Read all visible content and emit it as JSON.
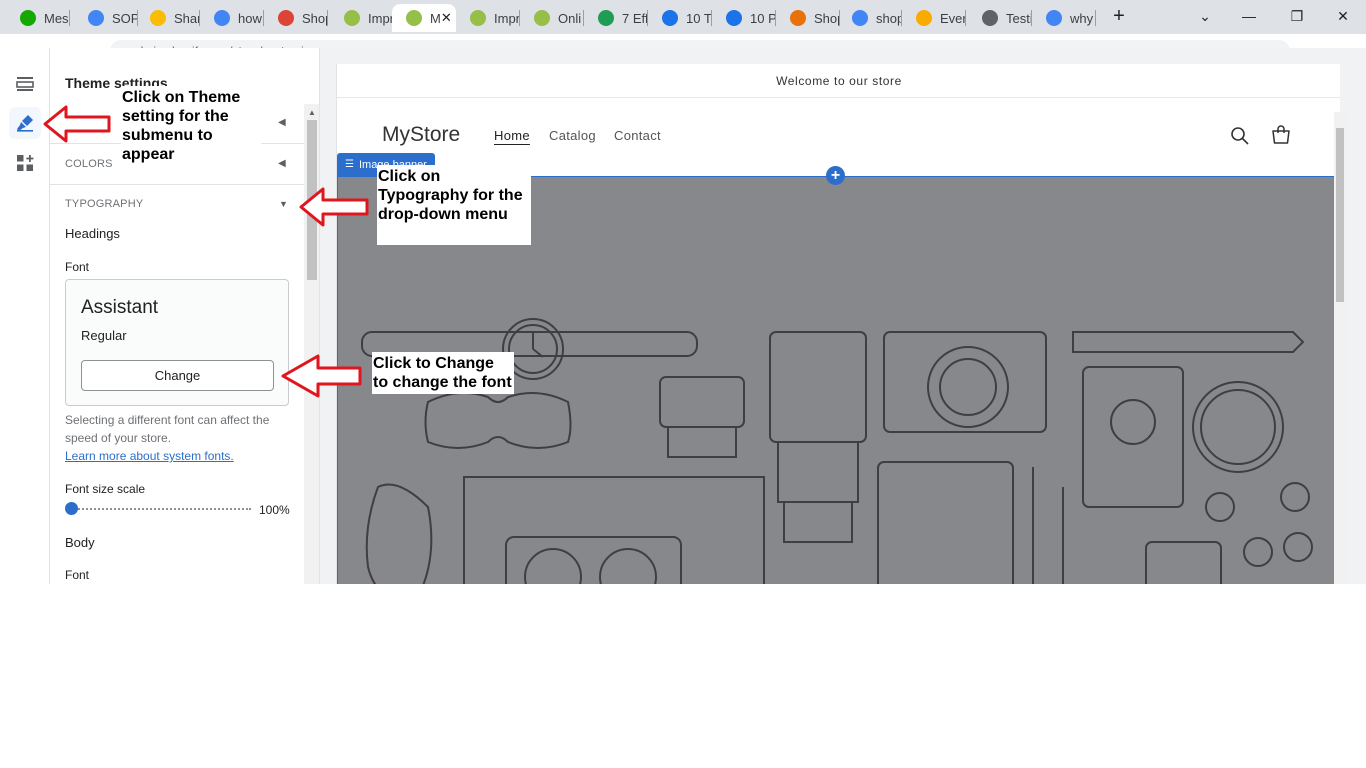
{
  "browser": {
    "tabs": [
      {
        "label": "Mes",
        "icon": "upwork-icon",
        "color": "#14a800"
      },
      {
        "label": "SOP",
        "icon": "docs-icon",
        "color": "#4285f4"
      },
      {
        "label": "Shar",
        "icon": "drive-icon",
        "color": "#fbbc04"
      },
      {
        "label": "how",
        "icon": "google-icon",
        "color": "#4285f4"
      },
      {
        "label": "Shop",
        "icon": "chrome-icon",
        "color": "#db4437"
      },
      {
        "label": "Impr",
        "icon": "shopify-icon",
        "color": "#95bf47"
      },
      {
        "label": "M",
        "icon": "shopify-icon",
        "color": "#95bf47"
      },
      {
        "label": "Impr",
        "icon": "shopify-icon",
        "color": "#95bf47"
      },
      {
        "label": "Onli",
        "icon": "shopify-icon",
        "color": "#95bf47"
      },
      {
        "label": "7 Eff",
        "icon": "f-icon",
        "color": "#1f9d55"
      },
      {
        "label": "10 T",
        "icon": "triangle-icon",
        "color": "#1a73e8"
      },
      {
        "label": "10 P",
        "icon": "triangle-icon",
        "color": "#1a73e8"
      },
      {
        "label": "Shop",
        "icon": "o-icon",
        "color": "#e8710a"
      },
      {
        "label": "shop",
        "icon": "google-icon",
        "color": "#4285f4"
      },
      {
        "label": "Ever",
        "icon": "pencil-icon",
        "color": "#f9ab00"
      },
      {
        "label": "Testi",
        "icon": "site-icon",
        "color": "#5f6368"
      },
      {
        "label": "why",
        "icon": "google-icon",
        "color": "#4285f4"
      }
    ],
    "new_tab": "+",
    "url": "admin.shopify.com/store/customize"
  },
  "panel": {
    "title": "Theme settings",
    "sections": [
      {
        "label": "",
        "state": "collapsed"
      },
      {
        "label": "COLORS",
        "state": "collapsed"
      },
      {
        "label": "TYPOGRAPHY",
        "state": "expanded"
      }
    ],
    "headings_label": "Headings",
    "font_label": "Font",
    "font_name": "Assistant",
    "font_style": "Regular",
    "change_label": "Change",
    "help_text": "Selecting a different font can affect the speed of your store.",
    "help_link": "Learn more about system fonts.",
    "size_scale_label": "Font size scale",
    "size_scale_value": "100%",
    "size_scale_fraction": 0,
    "body_label": "Body",
    "body_font_label": "Font"
  },
  "preview": {
    "announcement": "Welcome to our store",
    "logo": "MyStore",
    "nav": [
      "Home",
      "Catalog",
      "Contact"
    ],
    "section_tag": "Image banner"
  },
  "annotations": {
    "theme": "Click on Theme setting for the submenu to appear",
    "typography": "Click on Typography for the drop-down menu",
    "change": "Click to Change to change the font"
  },
  "colors": {
    "accent": "#2c6ecb",
    "banner": "#87888b",
    "arrow": "#e0161e"
  }
}
